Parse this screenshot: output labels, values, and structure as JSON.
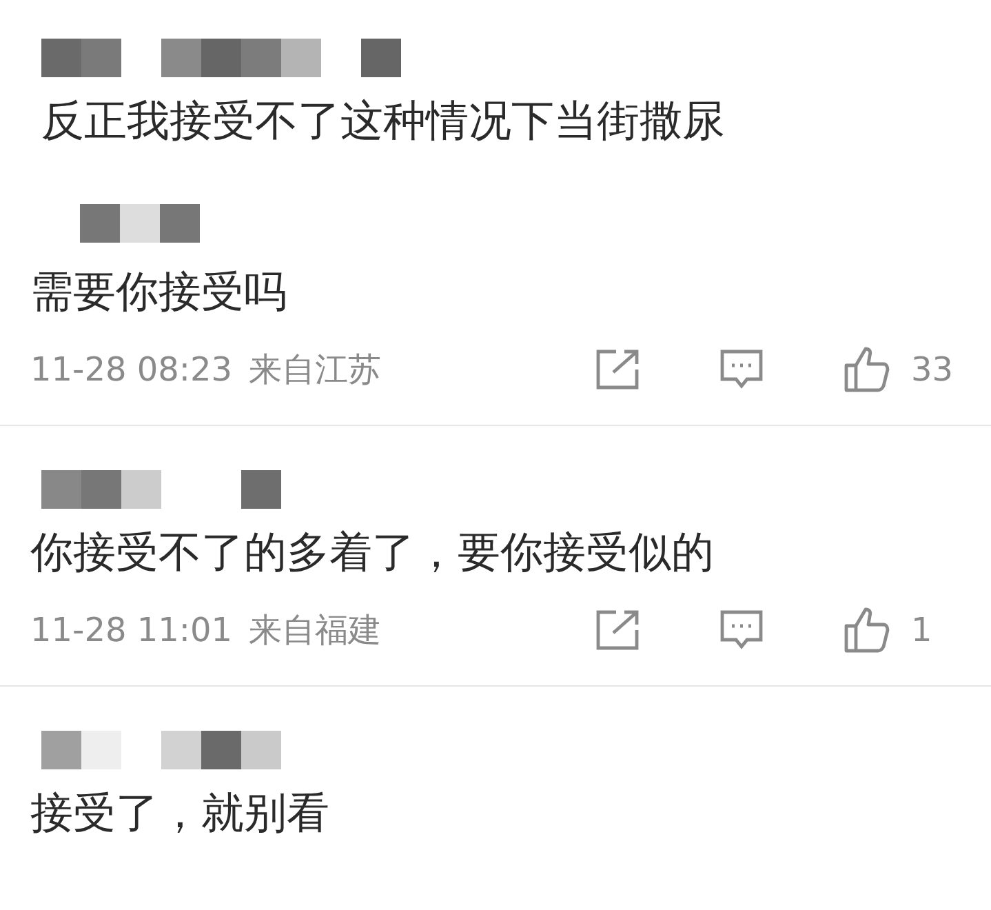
{
  "comments": [
    {
      "text": "反正我接受不了这种情况下当街撒尿"
    },
    {
      "text": "需要你接受吗",
      "time": "11-28 08:23",
      "location": "来自江苏",
      "likes": "33"
    },
    {
      "text": "你接受不了的多着了，要你接受似的",
      "time": "11-28 11:01",
      "location": "来自福建",
      "likes": "1"
    },
    {
      "text": "接受了，就别看"
    }
  ]
}
